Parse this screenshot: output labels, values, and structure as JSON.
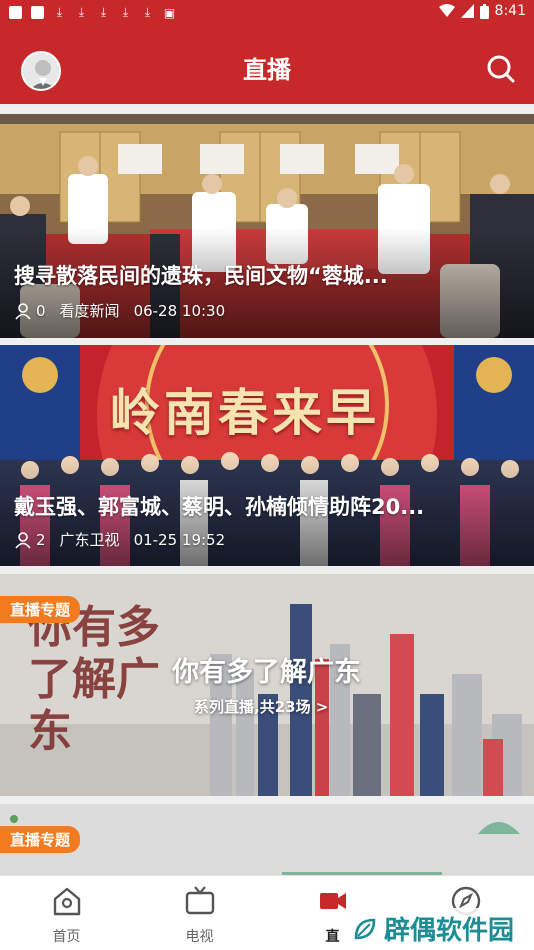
{
  "status_bar": {
    "time": "8:41",
    "notification_icons": [
      "app-icon",
      "app-icon",
      "download-icon",
      "download-icon",
      "download-icon",
      "download-icon",
      "download-icon",
      "image-icon"
    ]
  },
  "header": {
    "title": "直播",
    "accent_color": "#c7282a"
  },
  "feed": [
    {
      "type": "live",
      "title": "搜寻散落民间的遗珠，民间文物“蓉城...",
      "viewers": "0",
      "source": "看度新闻",
      "time": "06-28 10:30"
    },
    {
      "type": "live",
      "title": "戴玉强、郭富城、蔡明、孙楠倾情助阵20...",
      "viewers": "2",
      "source": "广东卫视",
      "time": "01-25 19:52",
      "banner_text": "岭南春来早"
    },
    {
      "type": "topic",
      "badge": "直播专题",
      "title": "你有多了解广东",
      "subtitle": "系列直播,共23场 >",
      "calligraphy": "你有多了解广东"
    },
    {
      "type": "topic",
      "badge": "直播专题"
    }
  ],
  "tabs": [
    {
      "label": "首页",
      "icon": "home-icon"
    },
    {
      "label": "电视",
      "icon": "tv-icon"
    },
    {
      "label": "直",
      "icon": "live-camera-icon",
      "active": true
    },
    {
      "label": "",
      "icon": "compass-icon"
    }
  ],
  "watermark": "辟偶软件园"
}
